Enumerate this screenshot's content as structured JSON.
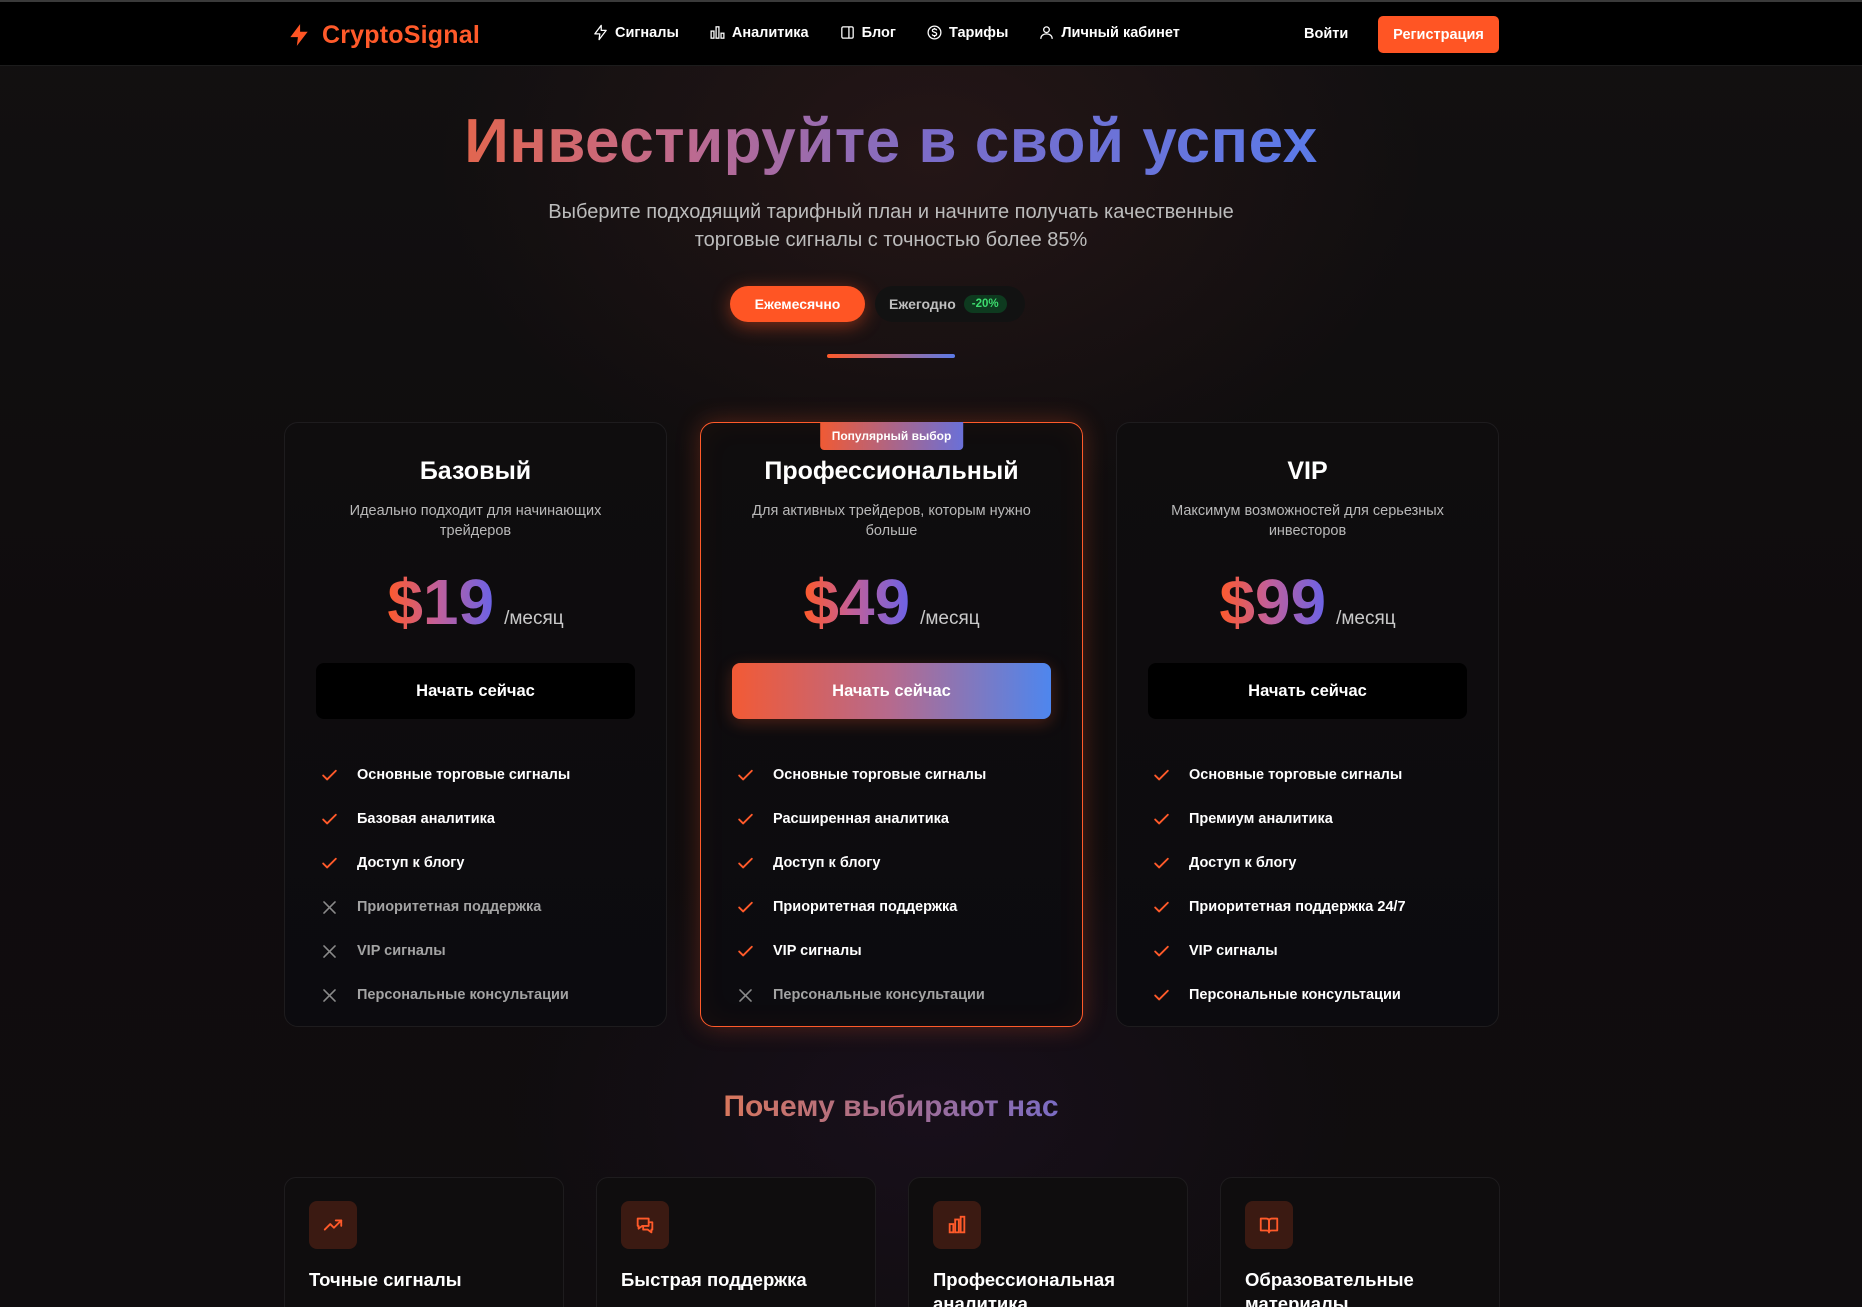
{
  "brand": {
    "name": "CryptoSignal",
    "accent": "#ff5524"
  },
  "nav": {
    "links": [
      {
        "label": "Сигналы",
        "icon": "lightning-icon"
      },
      {
        "label": "Аналитика",
        "icon": "bar-chart-icon"
      },
      {
        "label": "Блог",
        "icon": "document-icon"
      },
      {
        "label": "Тарифы",
        "icon": "dollar-circle-icon"
      },
      {
        "label": "Личный кабинет",
        "icon": "user-icon"
      }
    ],
    "login": "Войти",
    "register": "Регистрация"
  },
  "hero": {
    "title": "Инвестируйте в свой успех",
    "subtitle": "Выберите подходящий тарифный план и начните получать качественные торговые сигналы с точностью более 85%",
    "toggle": {
      "monthly": "Ежемесячно",
      "yearly": "Ежегодно",
      "discount": "-20%"
    }
  },
  "plans": [
    {
      "name": "Базовый",
      "description": "Идеально подходит для начинающих трейдеров",
      "price": "$19",
      "period": "/месяц",
      "button": "Начать сейчас",
      "features": [
        {
          "label": "Основные торговые сигналы",
          "included": true
        },
        {
          "label": "Базовая аналитика",
          "included": true
        },
        {
          "label": "Доступ к блогу",
          "included": true
        },
        {
          "label": "Приоритетная поддержка",
          "included": false
        },
        {
          "label": "VIP сигналы",
          "included": false
        },
        {
          "label": "Персональные консультации",
          "included": false
        }
      ]
    },
    {
      "name": "Профессиональный",
      "badge": "Популярный выбор",
      "description": "Для активных трейдеров, которым нужно больше",
      "price": "$49",
      "period": "/месяц",
      "button": "Начать сейчас",
      "features": [
        {
          "label": "Основные торговые сигналы",
          "included": true
        },
        {
          "label": "Расширенная аналитика",
          "included": true
        },
        {
          "label": "Доступ к блогу",
          "included": true
        },
        {
          "label": "Приоритетная поддержка",
          "included": true
        },
        {
          "label": "VIP сигналы",
          "included": true
        },
        {
          "label": "Персональные консультации",
          "included": false
        }
      ]
    },
    {
      "name": "VIP",
      "description": "Максимум возможностей для серьезных инвесторов",
      "price": "$99",
      "period": "/месяц",
      "button": "Начать сейчас",
      "features": [
        {
          "label": "Основные торговые сигналы",
          "included": true
        },
        {
          "label": "Премиум аналитика",
          "included": true
        },
        {
          "label": "Доступ к блогу",
          "included": true
        },
        {
          "label": "Приоритетная поддержка 24/7",
          "included": true
        },
        {
          "label": "VIP сигналы",
          "included": true
        },
        {
          "label": "Персональные консультации",
          "included": true
        }
      ]
    }
  ],
  "why": {
    "title": "Почему выбирают нас",
    "cards": [
      {
        "title": "Точные сигналы",
        "icon": "trending-up-icon"
      },
      {
        "title": "Быстрая поддержка",
        "icon": "chat-icon"
      },
      {
        "title": "Профессиональная аналитика",
        "icon": "bar-chart-icon"
      },
      {
        "title": "Образовательные материалы",
        "icon": "book-icon"
      }
    ]
  }
}
